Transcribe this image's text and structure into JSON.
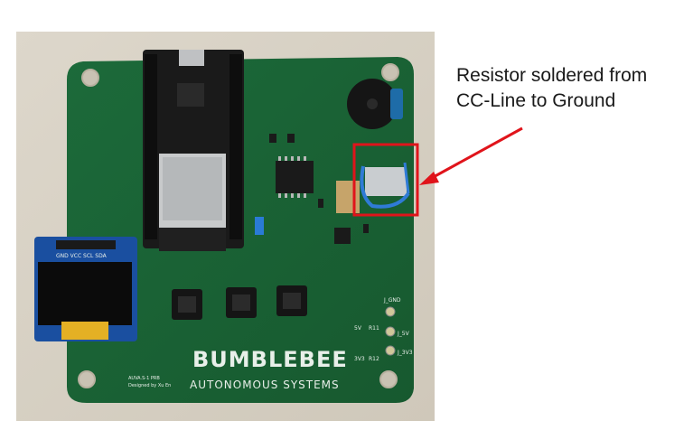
{
  "annotation": {
    "line1": "Resistor soldered from",
    "line2": "CC-Line to Ground",
    "highlight_color": "#e0141b"
  },
  "board": {
    "brand": "BUMBLEBEE",
    "tagline": "AUTONOMOUS SYSTEMS",
    "oled_pins": "GND VCC SCL SDA",
    "pad_labels": [
      "J_GND",
      "J_5V",
      "J_3V3"
    ],
    "led_labels": [
      "5V",
      "3V3"
    ],
    "resistor_labels": [
      "R11",
      "R12"
    ],
    "credit_line1": "AUVA.S-1 PRB",
    "credit_line2": "Designed by Xu En",
    "pcb_color": "#1f6b3c",
    "background_color": "#d9d3c7"
  }
}
